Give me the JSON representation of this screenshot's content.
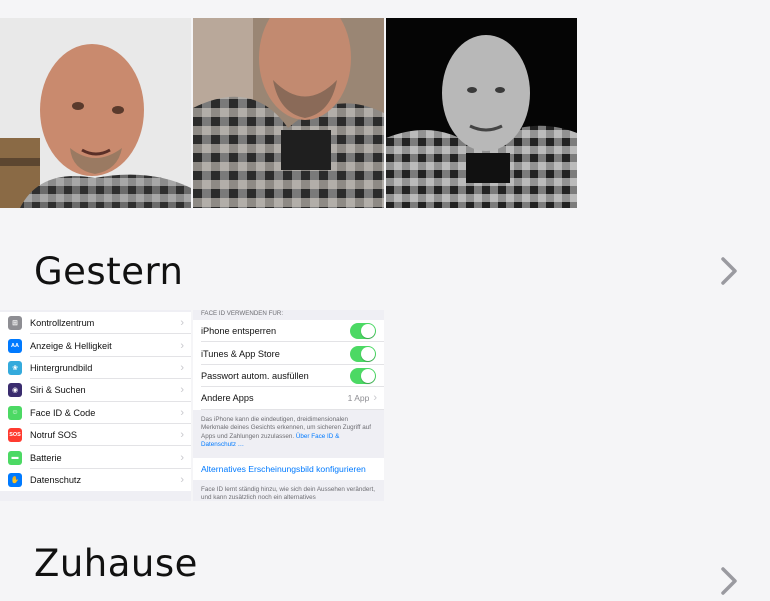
{
  "photos": [
    {
      "label": "portrait-1",
      "style": "color"
    },
    {
      "label": "portrait-2",
      "style": "color"
    },
    {
      "label": "portrait-3",
      "style": "monochrome"
    }
  ],
  "sections": {
    "yesterday": {
      "title": "Gestern"
    },
    "home": {
      "title": "Zuhause"
    }
  },
  "settings_list": [
    {
      "label": "Kontrollzentrum",
      "icon": "control-center-icon",
      "color": "#8e8e93",
      "glyph": "⊞"
    },
    {
      "label": "Anzeige & Helligkeit",
      "icon": "display-brightness-icon",
      "color": "#007aff",
      "glyph": "AA"
    },
    {
      "label": "Hintergrundbild",
      "icon": "wallpaper-icon",
      "color": "#34aadc",
      "glyph": "❀"
    },
    {
      "label": "Siri & Suchen",
      "icon": "siri-icon",
      "color": "#3a2c6e",
      "glyph": "◉"
    },
    {
      "label": "Face ID & Code",
      "icon": "face-id-icon",
      "color": "#4cd964",
      "glyph": "☺"
    },
    {
      "label": "Notruf SOS",
      "icon": "sos-icon",
      "color": "#ff3b30",
      "glyph": "SOS"
    },
    {
      "label": "Batterie",
      "icon": "battery-icon",
      "color": "#4cd964",
      "glyph": "▬"
    },
    {
      "label": "Datenschutz",
      "icon": "privacy-hand-icon",
      "color": "#007aff",
      "glyph": "✋"
    }
  ],
  "faceid": {
    "header": "FACE ID VERWENDEN FÜR:",
    "toggles": [
      {
        "label": "iPhone entsperren",
        "on": true
      },
      {
        "label": "iTunes & App Store",
        "on": true
      },
      {
        "label": "Passwort autom. ausfüllen",
        "on": true
      }
    ],
    "other_apps": {
      "label": "Andere Apps",
      "value": "1 App"
    },
    "note": "Das iPhone kann die eindeutigen, dreidimensionalen Merkmale deines Gesichts erkennen, um sicheren Zugriff auf Apps und Zahlungen zuzulassen.",
    "note_link": "Über Face ID & Datenschutz …",
    "alt_link": "Alternatives Erscheinungsbild konfigurieren",
    "note2": "Face ID lernt ständig hinzu, wie sich dein Aussehen verändert, und kann zusätzlich noch ein alternatives"
  },
  "colors": {
    "toggle_on": "#4cd964",
    "link": "#007aff",
    "background": "#f5f5f7"
  }
}
